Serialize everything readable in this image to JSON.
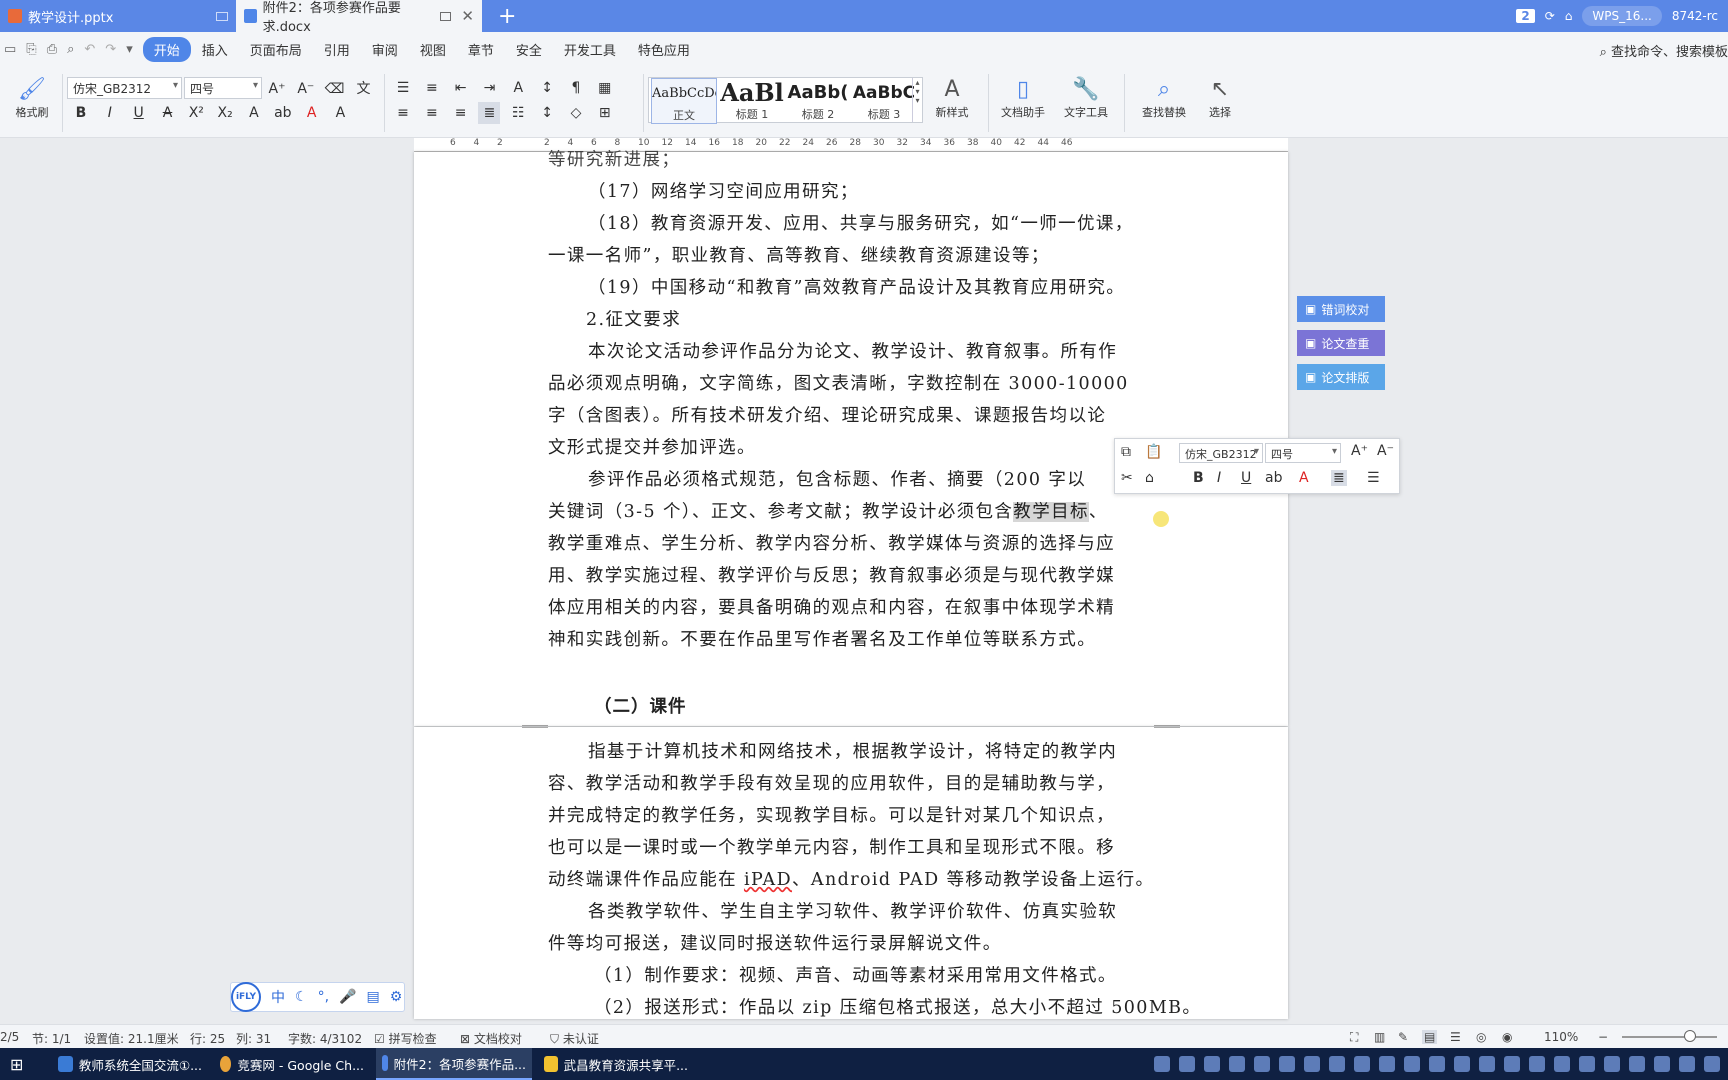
{
  "tabs": [
    {
      "label": "教学设计.pptx",
      "icon": "ppt-file-icon",
      "active": false
    },
    {
      "label": "附件2：各项参赛作品要求.docx",
      "icon": "doc-file-icon",
      "active": true
    }
  ],
  "titlebar_right": {
    "count": "2",
    "account": "WPS_16...",
    "user": "8742-rc"
  },
  "menu": {
    "items": [
      "开始",
      "插入",
      "页面布局",
      "引用",
      "审阅",
      "视图",
      "章节",
      "安全",
      "开发工具",
      "特色应用"
    ],
    "search": "查找命令、搜索模板"
  },
  "ribbon": {
    "format_painter": "格式刷",
    "font_name": "仿宋_GB2312",
    "font_size": "四号",
    "styles": [
      {
        "preview": "AaBbCcDd",
        "name": "正文"
      },
      {
        "preview": "AaBl",
        "name": "标题 1"
      },
      {
        "preview": "AaBb(",
        "name": "标题 2"
      },
      {
        "preview": "AaBbC",
        "name": "标题 3"
      }
    ],
    "new_style": "新样式",
    "doc_assistant": "文档助手",
    "text_tools": "文字工具",
    "find_replace": "查找替换",
    "select": "选择"
  },
  "ruler": {
    "ticks": [
      "6",
      "4",
      "2",
      "",
      "2",
      "4",
      "6",
      "8",
      "10",
      "12",
      "14",
      "16",
      "18",
      "20",
      "22",
      "24",
      "26",
      "28",
      "30",
      "32",
      "34",
      "36",
      "38",
      "40",
      "42",
      "44",
      "46"
    ]
  },
  "document": {
    "page1_lines": [
      "等研究新进展；",
      "（17）网络学习空间应用研究；",
      "（18）教育资源开发、应用、共享与服务研究，如“一师一优课，",
      "一课一名师”，职业教育、高等教育、继续教育资源建设等；",
      "（19）中国移动“和教育”高效教育产品设计及其教育应用研究。",
      "2.征文要求",
      "本次论文活动参评作品分为论文、教学设计、教育叙事。所有作",
      "品必须观点明确，文字简练，图文表清晰，字数控制在 3000-10000",
      "字（含图表）。所有技术研发介绍、理论研究成果、课题报告均以论",
      "文形式提交并参加评选。",
      "参评作品必须格式规范，包含标题、作者、摘要（200 字以",
      "关键词（3-5 个）、正文、参考文献；教学设计必须包含",
      "教学重难点、学生分析、教学内容分析、教学媒体与资源的选择与应",
      "用、教学实施过程、教学评价与反思；教育叙事必须是与现代教学媒",
      "体应用相关的内容，要具备明确的观点和内容，在叙事中体现学术精",
      "神和实践创新。不要在作品里写作者署名及工作单位等联系方式。"
    ],
    "highlight": "教学目标",
    "highlight_after": "、",
    "heading": "（二）课件",
    "page2_lines": [
      "指基于计算机技术和网络技术，根据教学设计，将特定的教学内",
      "容、教学活动和教学手段有效呈现的应用软件，目的是辅助教与学，",
      "并完成特定的教学任务，实现教学目标。可以是针对某几个知识点，",
      "也可以是一课时或一个教学单元内容，制作工具和呈现形式不限。移",
      "各类教学软件、学生自主学习软件、教学评价软件、仿真实验软",
      "件等均可报送，建议同时报送软件运行录屏解说文件。",
      "（1）制作要求：视频、声音、动画等素材采用常用文件格式。",
      "（2）报送形式：作品以 zip 压缩包格式报送，总大小不超过 500MB。"
    ],
    "page2_line5_before": "动终端课件作品应能在 ",
    "page2_line5_word": "iPAD",
    "page2_line5_after": "、Android PAD 等移动教学设备上运行。"
  },
  "side_buttons": [
    {
      "label": "错词校对",
      "color": "#5b8fe8"
    },
    {
      "label": "论文查重",
      "color": "#7b74d6"
    },
    {
      "label": "论文排版",
      "color": "#5ba6e8"
    }
  ],
  "mini_toolbar": {
    "font_name": "仿宋_GB2312",
    "font_size": "四号"
  },
  "ime": {
    "logo": "iFLY",
    "mode": "中"
  },
  "status": {
    "page": "2/5",
    "section": "节: 1/1",
    "setting": "设置值: 21.1厘米",
    "row": "行: 25",
    "col": "列: 31",
    "words": "字数: 4/3102",
    "spell": "拼写检查",
    "proof": "文档校对",
    "auth": "未认证",
    "zoom": "110%"
  },
  "taskbar": [
    {
      "label": "教师系统全国交流①...",
      "icon_color": "#3a7bd5"
    },
    {
      "label": "竞赛网 - Google Ch...",
      "icon_color": "#e8a33a"
    },
    {
      "label": "附件2：各项参赛作品...",
      "icon_color": "#4f86e8"
    },
    {
      "label": "武昌教育资源共享平...",
      "icon_color": "#f2c230"
    }
  ]
}
